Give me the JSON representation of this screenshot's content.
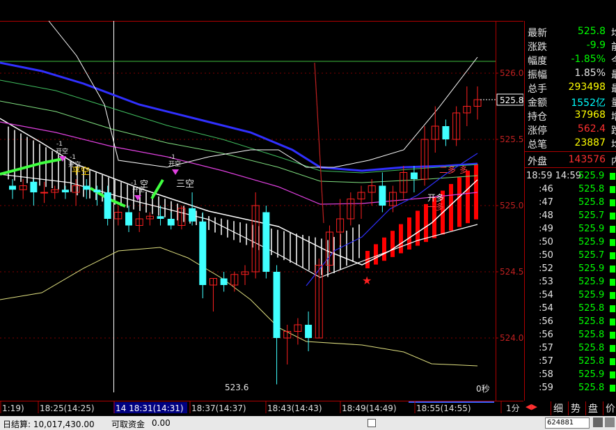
{
  "chart_data": {
    "type": "candlestick",
    "y_ticks": [
      "526.0",
      "525.5",
      "525.0",
      "524.5",
      "524.0"
    ],
    "last_price_tag": "525.8",
    "low_label": "523.6",
    "countdown": "0秒",
    "x_ticks": [
      "1:19)",
      "18:25(14:25)",
      "14 18:31(14:31)",
      "18:37(14:37)",
      "18:43(14:43)",
      "18:49(14:49)",
      "18:55(14:55)"
    ],
    "period": "1分",
    "annotations": {
      "kaikong1_a": "-1",
      "kaikong1_b": "开空",
      "kaikong2_a": "-1",
      "kaikong2_b": "开空",
      "pingkong": "平空",
      "kong1": "-1",
      "kong2": "空",
      "kong3": "-1",
      "sankong": "三空",
      "erdan": "二多",
      "duo": "多",
      "kaiduo": "开多",
      "yiduo": "一多"
    },
    "candles": [
      [
        525.15,
        525.2,
        525.05,
        525.12
      ],
      [
        525.12,
        525.2,
        525.05,
        525.15
      ],
      [
        525.18,
        525.2,
        525.0,
        525.1
      ],
      [
        525.1,
        525.18,
        525.02,
        525.1
      ],
      [
        525.1,
        525.15,
        525.05,
        525.12
      ],
      [
        525.12,
        525.15,
        525.05,
        525.1
      ],
      [
        525.1,
        525.2,
        525.0,
        525.15
      ],
      [
        525.15,
        525.2,
        525.05,
        525.12
      ],
      [
        525.12,
        525.15,
        525.0,
        525.1
      ],
      [
        525.1,
        525.15,
        524.85,
        524.9
      ],
      [
        524.9,
        525.0,
        524.85,
        524.95
      ],
      [
        524.95,
        525.0,
        524.8,
        524.85
      ],
      [
        524.85,
        524.95,
        524.8,
        524.9
      ],
      [
        524.9,
        524.95,
        524.85,
        524.92
      ],
      [
        524.92,
        525.0,
        524.85,
        524.9
      ],
      [
        524.9,
        524.95,
        524.82,
        524.85
      ],
      [
        524.85,
        525.0,
        524.82,
        524.98
      ],
      [
        524.98,
        525.1,
        524.85,
        524.88
      ],
      [
        524.88,
        524.95,
        524.3,
        524.4
      ],
      [
        524.4,
        524.45,
        524.2,
        524.45
      ],
      [
        524.45,
        524.5,
        524.35,
        524.4
      ],
      [
        524.4,
        524.5,
        524.35,
        524.48
      ],
      [
        524.48,
        524.55,
        524.4,
        524.5
      ],
      [
        524.5,
        525.1,
        524.45,
        525.0
      ],
      [
        524.95,
        525.0,
        524.45,
        524.5
      ],
      [
        524.5,
        524.55,
        523.65,
        524.0
      ],
      [
        524.0,
        524.1,
        523.8,
        524.05
      ],
      [
        524.05,
        524.15,
        523.95,
        524.1
      ],
      [
        524.1,
        524.2,
        523.9,
        524.0
      ],
      [
        524.0,
        524.6,
        524.0,
        524.55
      ],
      [
        524.55,
        524.85,
        524.5,
        524.8
      ],
      [
        524.8,
        525.05,
        524.7,
        524.9
      ],
      [
        524.9,
        525.1,
        524.85,
        525.05
      ],
      [
        525.05,
        525.15,
        524.9,
        525.1
      ],
      [
        525.1,
        525.2,
        525.0,
        525.15
      ],
      [
        525.15,
        525.25,
        524.95,
        525.0
      ],
      [
        525.0,
        525.15,
        524.95,
        525.1
      ],
      [
        525.1,
        525.3,
        525.05,
        525.25
      ],
      [
        525.25,
        525.3,
        525.1,
        525.2
      ],
      [
        525.2,
        525.6,
        525.15,
        525.5
      ],
      [
        525.5,
        525.75,
        525.4,
        525.6
      ],
      [
        525.6,
        525.65,
        525.45,
        525.5
      ],
      [
        525.5,
        525.75,
        525.45,
        525.7
      ],
      [
        525.7,
        525.9,
        525.6,
        525.75
      ],
      [
        525.75,
        525.9,
        525.65,
        525.8
      ]
    ]
  },
  "quote": {
    "rows": [
      {
        "label": "最新",
        "value": "525.8",
        "color": "#00ff00",
        "cut": "均"
      },
      {
        "label": "涨跌",
        "value": "-9.9",
        "color": "#00ff00",
        "cut": "前"
      },
      {
        "label": "幅度",
        "value": "-1.85%",
        "color": "#00ff00",
        "cut": "今"
      },
      {
        "label": "振幅",
        "value": "1.85%",
        "color": "#e6e6e6",
        "cut": "最"
      },
      {
        "label": "总手",
        "value": "293498",
        "color": "#ffff00",
        "cut": "最"
      },
      {
        "label": "金额",
        "value": "1552亿",
        "color": "#00ffff",
        "cut": "量"
      },
      {
        "label": "持仓",
        "value": "37968",
        "color": "#ffff00",
        "cut": "增"
      },
      {
        "label": "涨停",
        "value": "562.4",
        "color": "#ff3030",
        "cut": "跌"
      },
      {
        "label": "总笔",
        "value": "23887",
        "color": "#ffff00",
        "cut": "均"
      }
    ],
    "outer_label": "外盘",
    "outer_value": "143576",
    "outer_cut": "内"
  },
  "ticks": [
    {
      "time": "18:59 14:59",
      "price": "525.9"
    },
    {
      "time": ":46",
      "price": "525.8"
    },
    {
      "time": ":47",
      "price": "525.8"
    },
    {
      "time": ":48",
      "price": "525.7"
    },
    {
      "time": ":49",
      "price": "525.9"
    },
    {
      "time": ":50",
      "price": "525.9"
    },
    {
      "time": ":50",
      "price": "525.7"
    },
    {
      "time": ":52",
      "price": "525.9"
    },
    {
      "time": ":53",
      "price": "525.9"
    },
    {
      "time": ":54",
      "price": "525.9"
    },
    {
      "time": ":54",
      "price": "525.8"
    },
    {
      "time": ":56",
      "price": "525.8"
    },
    {
      "time": ":56",
      "price": "525.8"
    },
    {
      "time": ":57",
      "price": "525.8"
    },
    {
      "time": ":57",
      "price": "525.8"
    },
    {
      "time": ":58",
      "price": "525.9"
    },
    {
      "time": ":59",
      "price": "525.8"
    }
  ],
  "tabs": [
    "细",
    "势",
    "盘",
    "价"
  ],
  "status": {
    "left_label": "可取资金",
    "left_value": "0.00",
    "balance": "日结算: 10,017,430.00",
    "account": "624881"
  }
}
